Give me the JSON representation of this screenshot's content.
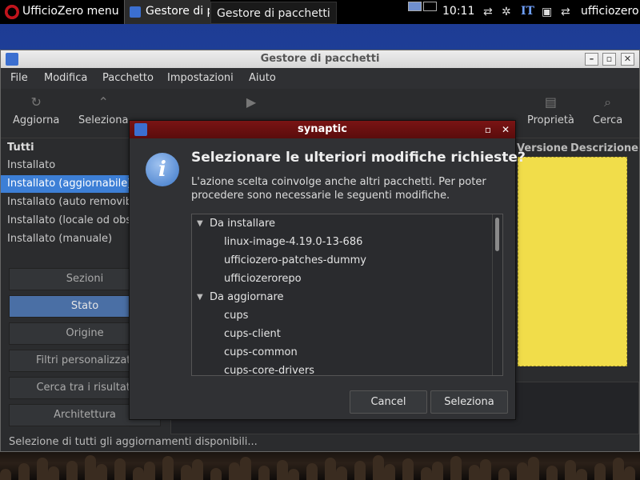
{
  "topbar": {
    "menu_label": "UfficioZero menu",
    "task_label": "Gestore di pacchetti",
    "tooltip": "Gestore di pacchetti",
    "clock": "10:11",
    "keyboard_lang": "IT",
    "user": "ufficiozero"
  },
  "window": {
    "title": "Gestore di pacchetti",
    "menu": [
      "File",
      "Modifica",
      "Pacchetto",
      "Impostazioni",
      "Aiuto"
    ],
    "toolbar": {
      "reload": "Aggiorna",
      "select": "Seleziona",
      "properties": "Proprietà",
      "search": "Cerca"
    },
    "filters_header": "Tutti",
    "filters": [
      "Installato",
      "Installato (aggiornabile)",
      "Installato (auto removibile)",
      "Installato (locale od obsoleto)",
      "Installato (manuale)"
    ],
    "side_buttons": [
      "Sezioni",
      "Stato",
      "Origine",
      "Filtri personalizzati",
      "Cerca tra i risultati",
      "Architettura"
    ],
    "columns": {
      "version": "Versione",
      "description": "Descrizione"
    },
    "statusbar": "Selezione di tutti gli aggiornamenti disponibili..."
  },
  "dialog": {
    "title": "synaptic",
    "heading": "Selezionare le ulteriori modifiche richieste?",
    "message": "L'azione scelta coinvolge anche altri pacchetti. Per poter procedere sono necessarie le seguenti modifiche.",
    "groups": [
      {
        "label": "Da installare",
        "items": [
          "linux-image-4.19.0-13-686",
          "ufficiozero-patches-dummy",
          "ufficiozerorepo"
        ]
      },
      {
        "label": "Da aggiornare",
        "items": [
          "cups",
          "cups-client",
          "cups-common",
          "cups-core-drivers"
        ]
      }
    ],
    "cancel": "Cancel",
    "confirm": "Seleziona"
  }
}
